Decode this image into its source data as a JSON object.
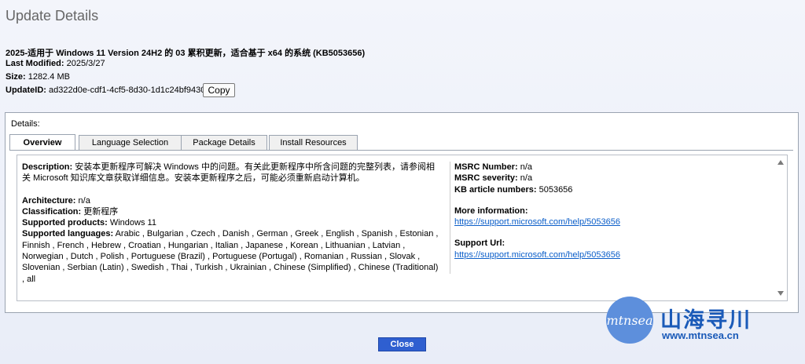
{
  "title": "Update Details",
  "update": {
    "name": "2025-适用于 Windows 11 Version 24H2 的 03 累积更新，适合基于 x64 的系统 (KB5053656)",
    "last_modified_label": "Last Modified:",
    "last_modified": "2025/3/27",
    "size_label": "Size:",
    "size": "1282.4 MB",
    "update_id_label": "UpdateID:",
    "update_id": "ad322d0e-cdf1-4cf5-8d30-1d1c24bf9430",
    "copy_label": "Copy"
  },
  "details": {
    "label": "Details:",
    "tabs": [
      "Overview",
      "Language Selection",
      "Package Details",
      "Install Resources"
    ],
    "active_tab": "Overview",
    "overview": {
      "description_label": "Description:",
      "description": "安装本更新程序可解决 Windows 中的问题。有关此更新程序中所含问题的完整列表，请参阅相关 Microsoft 知识库文章获取详细信息。安装本更新程序之后，可能必须重新启动计算机。",
      "architecture_label": "Architecture:",
      "architecture": "n/a",
      "classification_label": "Classification:",
      "classification": "更新程序",
      "products_label": "Supported products:",
      "products": "Windows 11",
      "languages_label": "Supported languages:",
      "languages": "Arabic , Bulgarian , Czech , Danish , German , Greek , English , Spanish , Estonian , Finnish , French , Hebrew , Croatian , Hungarian , Italian , Japanese , Korean , Lithuanian , Latvian , Norwegian , Dutch , Polish , Portuguese (Brazil) , Portuguese (Portugal) , Romanian , Russian , Slovak , Slovenian , Serbian (Latin) , Swedish , Thai , Turkish , Ukrainian , Chinese (Simplified) , Chinese (Traditional) , all",
      "msrc_number_label": "MSRC Number:",
      "msrc_number": "n/a",
      "msrc_severity_label": "MSRC severity:",
      "msrc_severity": "n/a",
      "kb_label": "KB article numbers:",
      "kb": "5053656",
      "more_info_label": "More information:",
      "more_info_url": "https://support.microsoft.com/help/5053656",
      "support_url_label": "Support Url:",
      "support_url": "https://support.microsoft.com/help/5053656"
    }
  },
  "close_label": "Close",
  "watermark": {
    "logo_text": "mtnsea",
    "title": "山海寻川",
    "url": "www.mtnsea.cn"
  },
  "colors": {
    "accent": "#2f5fd0",
    "link": "#0b5ec9",
    "watermark": "#1a5ab8"
  }
}
